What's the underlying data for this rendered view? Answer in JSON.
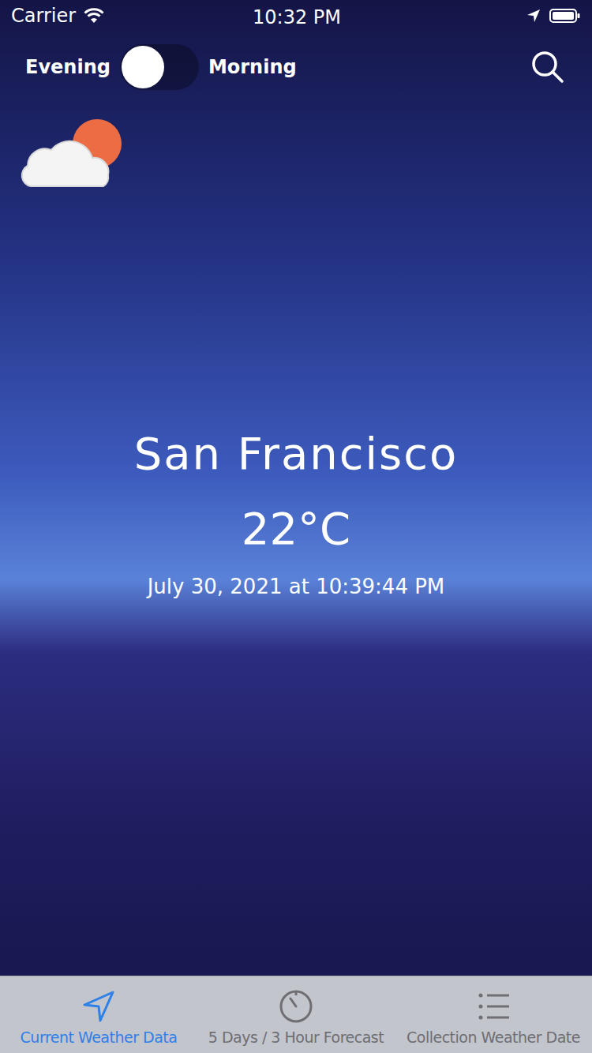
{
  "status_bar": {
    "carrier": "Carrier",
    "time": "10:32 PM"
  },
  "mode_toggle": {
    "left_label": "Evening",
    "right_label": "Morning",
    "on": false
  },
  "weather": {
    "city": "San Francisco",
    "temperature": "22°C",
    "updated": "July 30, 2021 at 10:39:44 PM"
  },
  "tabs": [
    {
      "label": "Current Weather Data",
      "selected": true,
      "kind": "location"
    },
    {
      "label": "5 Days / 3 Hour Forecast",
      "selected": false,
      "kind": "timer"
    },
    {
      "label": "Collection Weather Date",
      "selected": false,
      "kind": "list"
    }
  ]
}
